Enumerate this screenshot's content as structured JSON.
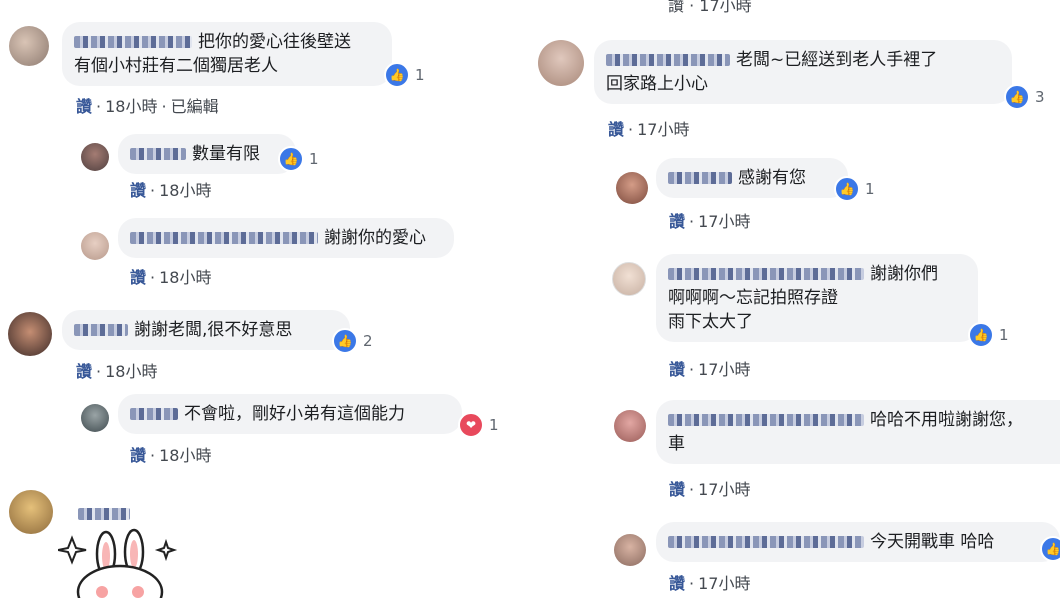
{
  "left": {
    "top_cut": "",
    "comments": [
      {
        "lines": [
          "把你的愛心往後壁送",
          "有個小村莊有二個獨居老人"
        ],
        "reactions": "1",
        "react_type": "like",
        "like": "讚",
        "time": "18小時",
        "edited": "已編輯"
      },
      {
        "lines": [
          "數量有限"
        ],
        "reactions": "1",
        "react_type": "like",
        "like": "讚",
        "time": "18小時"
      },
      {
        "lines": [
          "謝謝你的愛心"
        ],
        "like": "讚",
        "time": "18小時"
      },
      {
        "lines": [
          "謝謝老闆,很不好意思"
        ],
        "reactions": "2",
        "react_type": "like",
        "like": "讚",
        "time": "18小時"
      },
      {
        "lines": [
          "不會啦，剛好小弟有這個能力"
        ],
        "reactions": "1",
        "react_type": "love",
        "like": "讚",
        "time": "18小時"
      }
    ]
  },
  "right": {
    "top_cut": "讚 · 17小時",
    "comments": [
      {
        "lines": [
          "老闆~已經送到老人手裡了",
          "回家路上小心"
        ],
        "reactions": "3",
        "react_type": "like",
        "like": "讚",
        "time": "17小時"
      },
      {
        "lines": [
          "感謝有您"
        ],
        "reactions": "1",
        "react_type": "like",
        "like": "讚",
        "time": "17小時"
      },
      {
        "lines": [
          "謝謝你們",
          "啊啊啊～忘記拍照存證",
          "雨下太大了"
        ],
        "reactions": "1",
        "react_type": "like",
        "like": "讚",
        "time": "17小時"
      },
      {
        "lines": [
          "哈哈不用啦謝謝您，",
          "車"
        ],
        "like": "讚",
        "time": "17小時"
      },
      {
        "lines": [
          "今天開戰車 哈哈"
        ],
        "like": "讚",
        "time": "17小時"
      }
    ]
  },
  "colors": {
    "bubble": "#f2f3f5",
    "like": "#3b78e7",
    "love": "#e8495c",
    "action": "#385898"
  },
  "icons": {
    "like": "thumbs-up-icon",
    "love": "heart-icon"
  }
}
